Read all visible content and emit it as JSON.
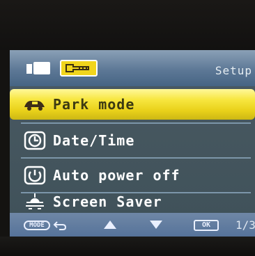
{
  "header": {
    "title": "Setup"
  },
  "tabs": [
    {
      "name": "video",
      "icon": "camera-icon",
      "active": false
    },
    {
      "name": "setup",
      "icon": "wrench-icon",
      "active": true
    }
  ],
  "menu": [
    {
      "label": "Park mode",
      "icon": "car-shield-icon",
      "selected": true
    },
    {
      "label": "Date/Time",
      "icon": "clock-icon",
      "selected": false
    },
    {
      "label": "Auto power off",
      "icon": "power-icon",
      "selected": false
    },
    {
      "label": "Screen Saver",
      "icon": "sun-icon",
      "selected": false
    }
  ],
  "footer": {
    "mode_label": "MODE",
    "ok_label": "OK",
    "page": "1/3"
  },
  "colors": {
    "selection": "#f7e63f",
    "header": "#5d7896",
    "background": "#4a5a63"
  }
}
